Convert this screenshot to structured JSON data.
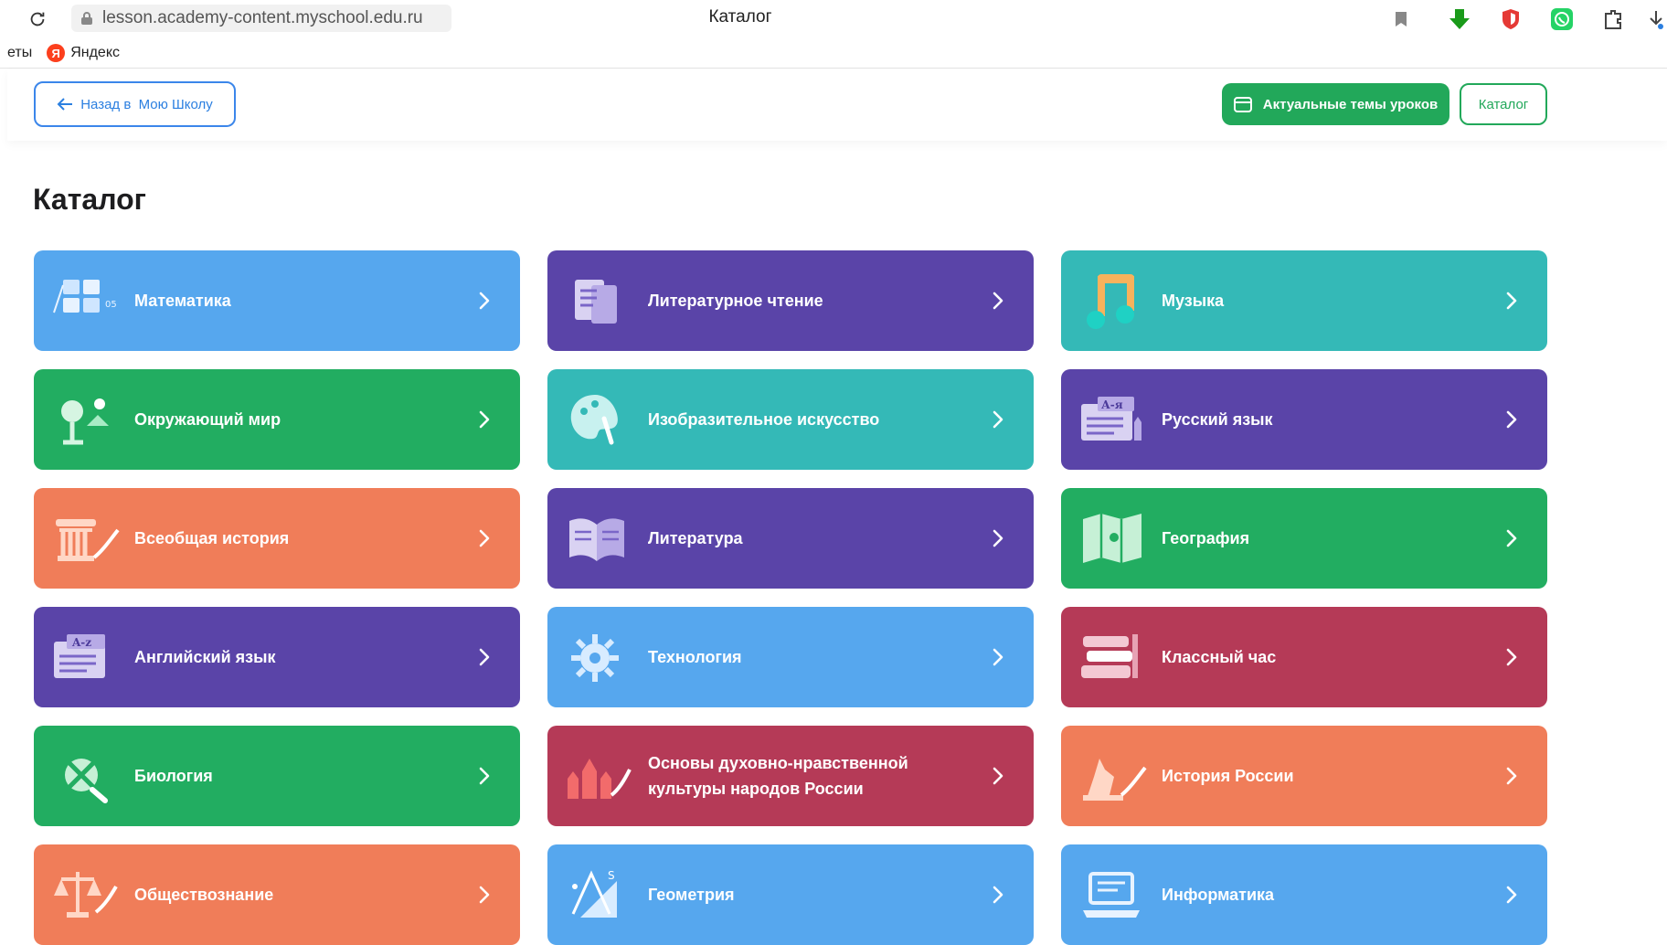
{
  "browser": {
    "url": "lesson.academy-content.myschool.edu.ru",
    "tab_title": "Каталог",
    "bookmarks": [
      {
        "label": "еты"
      },
      {
        "label": "Яндекс",
        "icon": "yandex-logo-icon",
        "logo_letter": "Я"
      }
    ]
  },
  "header": {
    "back_label": "Назад в  Мою Школу",
    "topics_label": "Актуальные темы уроков",
    "catalog_label": "Каталог"
  },
  "page": {
    "title": "Каталог"
  },
  "colors": {
    "blue": "#56a7ee",
    "purple": "#5a44a8",
    "teal": "#34b9b7",
    "green": "#22ad61",
    "orange": "#f07d59",
    "red": "#b53a57",
    "accent_green": "#22a85a",
    "accent_blue": "#3b86ea"
  },
  "subjects": [
    {
      "label": "Математика",
      "color": "blue",
      "icon": "math-icon"
    },
    {
      "label": "Литературное чтение",
      "color": "purple",
      "icon": "reading-icon"
    },
    {
      "label": "Музыка",
      "color": "teal",
      "icon": "music-note-icon"
    },
    {
      "label": "Окружающий мир",
      "color": "green",
      "icon": "nature-icon"
    },
    {
      "label": "Изобразительное искусство",
      "color": "teal",
      "icon": "palette-icon"
    },
    {
      "label": "Русский язык",
      "color": "purple",
      "icon": "russian-language-icon"
    },
    {
      "label": "Всеобщая история",
      "color": "orange",
      "icon": "column-icon"
    },
    {
      "label": "Литература",
      "color": "purple",
      "icon": "open-book-icon"
    },
    {
      "label": "География",
      "color": "green",
      "icon": "map-icon"
    },
    {
      "label": "Английский язык",
      "color": "purple",
      "icon": "english-language-icon"
    },
    {
      "label": "Технология",
      "color": "blue",
      "icon": "gear-icon"
    },
    {
      "label": "Классный час",
      "color": "red",
      "icon": "books-stack-icon"
    },
    {
      "label": "Биология",
      "color": "green",
      "icon": "biology-icon"
    },
    {
      "label": "Основы духовно-нравственной культуры народов России",
      "color": "red",
      "icon": "kremlin-icon"
    },
    {
      "label": "История России",
      "color": "orange",
      "icon": "monument-icon"
    },
    {
      "label": "Обществознание",
      "color": "orange",
      "icon": "scales-icon"
    },
    {
      "label": "Геометрия",
      "color": "blue",
      "icon": "geometry-icon"
    },
    {
      "label": "Информатика",
      "color": "blue",
      "icon": "laptop-icon"
    }
  ]
}
